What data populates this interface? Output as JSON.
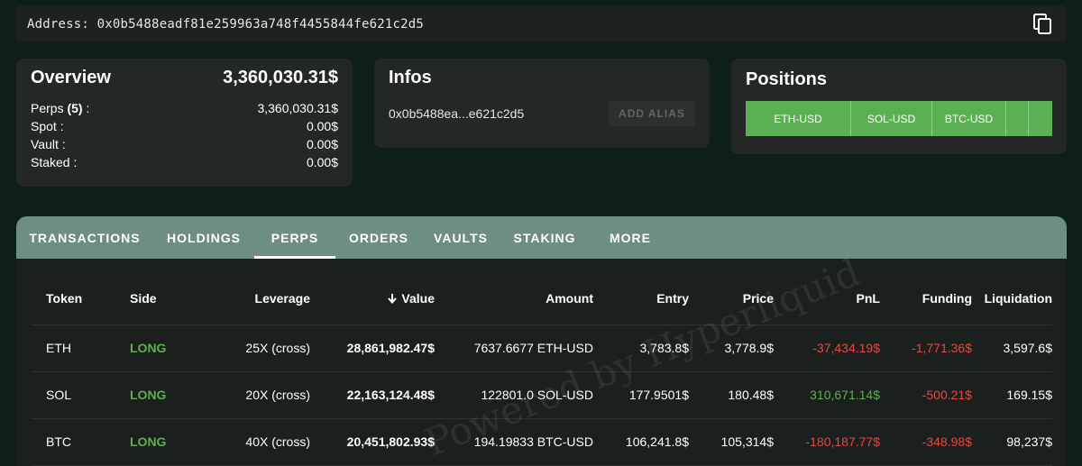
{
  "address_bar": {
    "label": "Address: 0x0b5488eadf81e259963a748f4455844fe621c2d5",
    "copy_icon": "copy-icon"
  },
  "overview": {
    "title": "Overview",
    "total": "3,360,030.31$",
    "rows": [
      {
        "label_prefix": "Perps ",
        "label_count": "(5)",
        "label_suffix": " :",
        "value": "3,360,030.31$"
      },
      {
        "label": "Spot :",
        "value": "0.00$"
      },
      {
        "label": "Vault :",
        "value": "0.00$"
      },
      {
        "label": "Staked :",
        "value": "0.00$"
      }
    ]
  },
  "infos": {
    "title": "Infos",
    "short_address": "0x0b5488ea...e621c2d5",
    "add_alias_label": "ADD ALIAS"
  },
  "positions": {
    "title": "Positions",
    "segments": [
      {
        "label": "ETH-USD"
      },
      {
        "label": "SOL-USD"
      },
      {
        "label": "BTC-USD"
      },
      {
        "label": ""
      },
      {
        "label": ""
      }
    ],
    "bar_color": "#5ab052"
  },
  "tabs": [
    {
      "label": "TRANSACTIONS"
    },
    {
      "label": "HOLDINGS"
    },
    {
      "label": "PERPS",
      "active": true
    },
    {
      "label": "ORDERS"
    },
    {
      "label": "VAULTS"
    },
    {
      "label": "STAKING"
    },
    {
      "label": "MORE"
    }
  ],
  "table": {
    "headers": {
      "token": "Token",
      "side": "Side",
      "leverage": "Leverage",
      "value": "Value",
      "amount": "Amount",
      "entry": "Entry",
      "price": "Price",
      "pnl": "PnL",
      "funding": "Funding",
      "liquidation": "Liquidation"
    },
    "sort_icon": "arrow-down-icon",
    "rows": [
      {
        "token": "ETH",
        "side": "LONG",
        "leverage": "25X (cross)",
        "value": "28,861,982.47$",
        "amount": "7637.6677 ETH-USD",
        "entry": "3,783.8$",
        "price": "3,778.9$",
        "pnl": "-37,434.19$",
        "pnl_sign": "neg",
        "funding": "-1,771.36$",
        "liquidation": "3,597.6$"
      },
      {
        "token": "SOL",
        "side": "LONG",
        "leverage": "20X (cross)",
        "value": "22,163,124.48$",
        "amount": "122801.0 SOL-USD",
        "entry": "177.9501$",
        "price": "180.48$",
        "pnl": "310,671.14$",
        "pnl_sign": "pos",
        "funding": "-500.21$",
        "liquidation": "169.15$"
      },
      {
        "token": "BTC",
        "side": "LONG",
        "leverage": "40X (cross)",
        "value": "20,451,802.93$",
        "amount": "194.19833 BTC-USD",
        "entry": "106,241.8$",
        "price": "105,314$",
        "pnl": "-180,187.77$",
        "pnl_sign": "neg",
        "funding": "-348.98$",
        "liquidation": "98,237$"
      }
    ]
  },
  "watermark": "Powered by Hyperliquid",
  "colors": {
    "background": "#0e1e1b",
    "card": "#232725",
    "tab_bar": "#6e8d85",
    "long_green": "#5fae50",
    "negative_red": "#e24a42"
  }
}
